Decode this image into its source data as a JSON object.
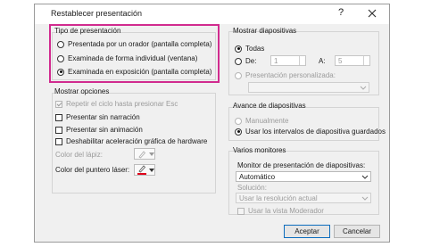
{
  "dialog": {
    "title": "Restablecer presentación",
    "help": "?"
  },
  "tipo": {
    "title": "Tipo de presentación",
    "options": [
      {
        "label": "Presentada por un orador (pantalla completa)",
        "checked": false
      },
      {
        "label": "Examinada de forma individual (ventana)",
        "checked": false
      },
      {
        "label": "Examinada en exposición (pantalla completa)",
        "checked": true
      }
    ]
  },
  "mostrar_opciones": {
    "title": "Mostrar opciones",
    "checks": [
      {
        "label": "Repetir el ciclo hasta presionar Esc",
        "checked": true,
        "disabled": true
      },
      {
        "label": "Presentar sin narración",
        "checked": false
      },
      {
        "label": "Presentar sin animación",
        "checked": false
      },
      {
        "label": "Deshabilitar aceleración gráfica de hardware",
        "checked": false
      }
    ],
    "pen_color_label": "Color del lápiz:",
    "pointer_color_label": "Color del puntero láser:",
    "pointer_color": "#e0001b"
  },
  "mostrar_diapositivas": {
    "title": "Mostrar diapositivas",
    "todas_label": "Todas",
    "de_label": "De:",
    "de_value": "1",
    "a_label": "A:",
    "a_value": "5",
    "personalizada_label": "Presentación personalizada:"
  },
  "avance": {
    "title": "Avance de diapositivas",
    "manual_label": "Manualmente",
    "intervalos_label": "Usar los intervalos de diapositiva guardados"
  },
  "monitores": {
    "title": "Varios monitores",
    "monitor_label": "Monitor de presentación de diapositivas:",
    "monitor_value": "Automático",
    "solucion_label": "Solución:",
    "solucion_value": "Usar la resolución actual",
    "moderador_label": "Usar la vista Moderador"
  },
  "buttons": {
    "accept": "Aceptar",
    "cancel": "Cancelar"
  },
  "colors": {
    "highlight": "#d12b8f",
    "accent": "#0b6cbd"
  }
}
